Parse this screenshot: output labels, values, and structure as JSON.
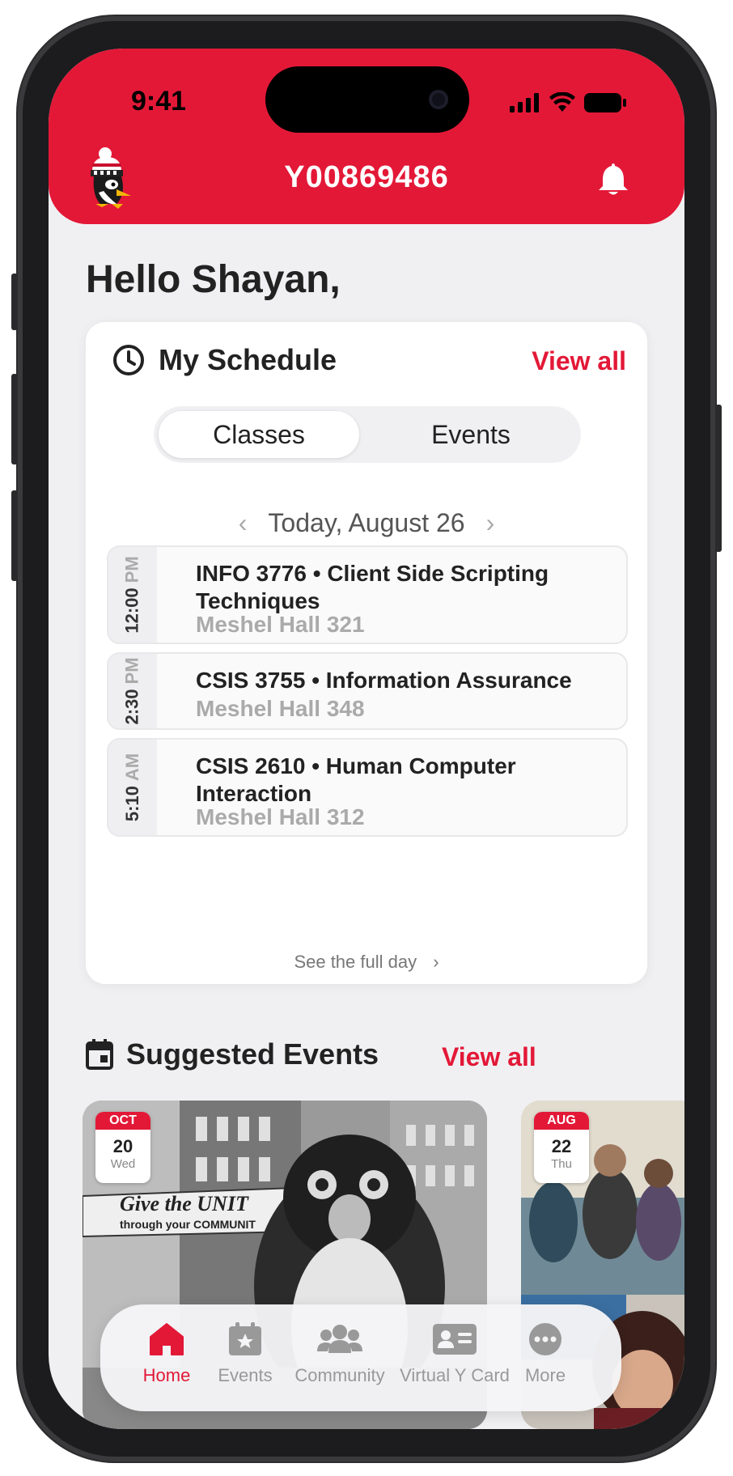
{
  "status_bar": {
    "time": "9:41"
  },
  "header": {
    "title": "Y00869486"
  },
  "greeting": "Hello Shayan,",
  "schedule": {
    "title": "My Schedule",
    "view_all": "View all",
    "tabs": [
      "Classes",
      "Events"
    ],
    "date": "Today, August 26",
    "classes": [
      {
        "time": "12:00",
        "ampm": "PM",
        "title": "INFO 3776 • Client Side Scripting Techniques",
        "location": "Meshel Hall 321"
      },
      {
        "time": "2:30",
        "ampm": "PM",
        "title": "CSIS 3755 • Information Assurance",
        "location": "Meshel Hall 348"
      },
      {
        "time": "5:10",
        "ampm": "AM",
        "title": "CSIS 2610 • Human Computer Interaction",
        "location": "Meshel Hall 312"
      }
    ],
    "full_day_link": "See the full day"
  },
  "suggested_events": {
    "title": "Suggested Events",
    "view_all": "View all",
    "events": [
      {
        "month": "OCT",
        "day": "20",
        "weekday": "Wed",
        "banner_text": "Give the UNIT",
        "banner_sub": "through your COMMUNIT"
      },
      {
        "month": "AUG",
        "day": "22",
        "weekday": "Thu"
      }
    ]
  },
  "tabbar": {
    "items": [
      {
        "label": "Home",
        "icon": "home-icon"
      },
      {
        "label": "Events",
        "icon": "calendar-star-icon"
      },
      {
        "label": "Community",
        "icon": "people-icon"
      },
      {
        "label": "Virtual Y Card",
        "icon": "id-card-icon"
      },
      {
        "label": "More",
        "icon": "more-icon"
      }
    ],
    "active": "Home"
  },
  "colors": {
    "brand_red": "#e31837",
    "background": "#f0f0f2"
  }
}
